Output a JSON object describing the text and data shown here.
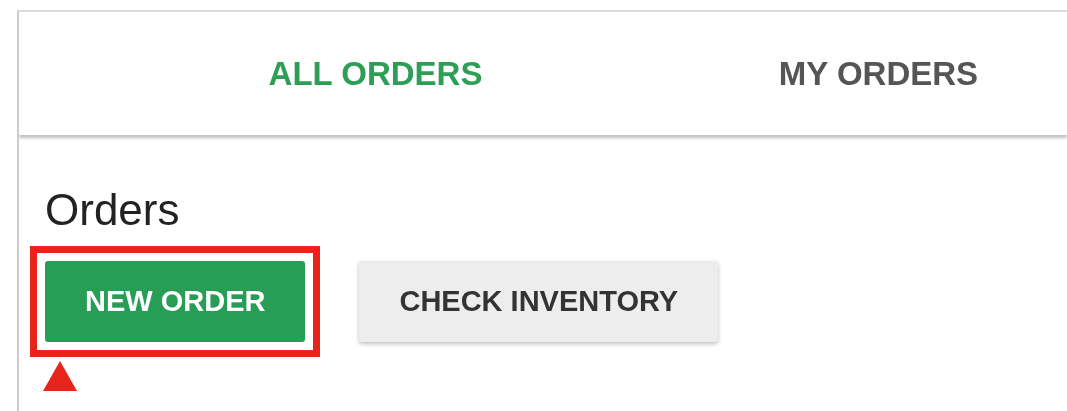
{
  "tabs": [
    {
      "label": "ALL ORDERS",
      "selected": true
    },
    {
      "label": "MY ORDERS",
      "selected": false
    }
  ],
  "heading": "Orders",
  "buttons": [
    {
      "label": "NEW ORDER",
      "kind": "primary",
      "highlighted": true
    },
    {
      "label": "CHECK INVENTORY",
      "kind": "secondary",
      "highlighted": false
    }
  ]
}
